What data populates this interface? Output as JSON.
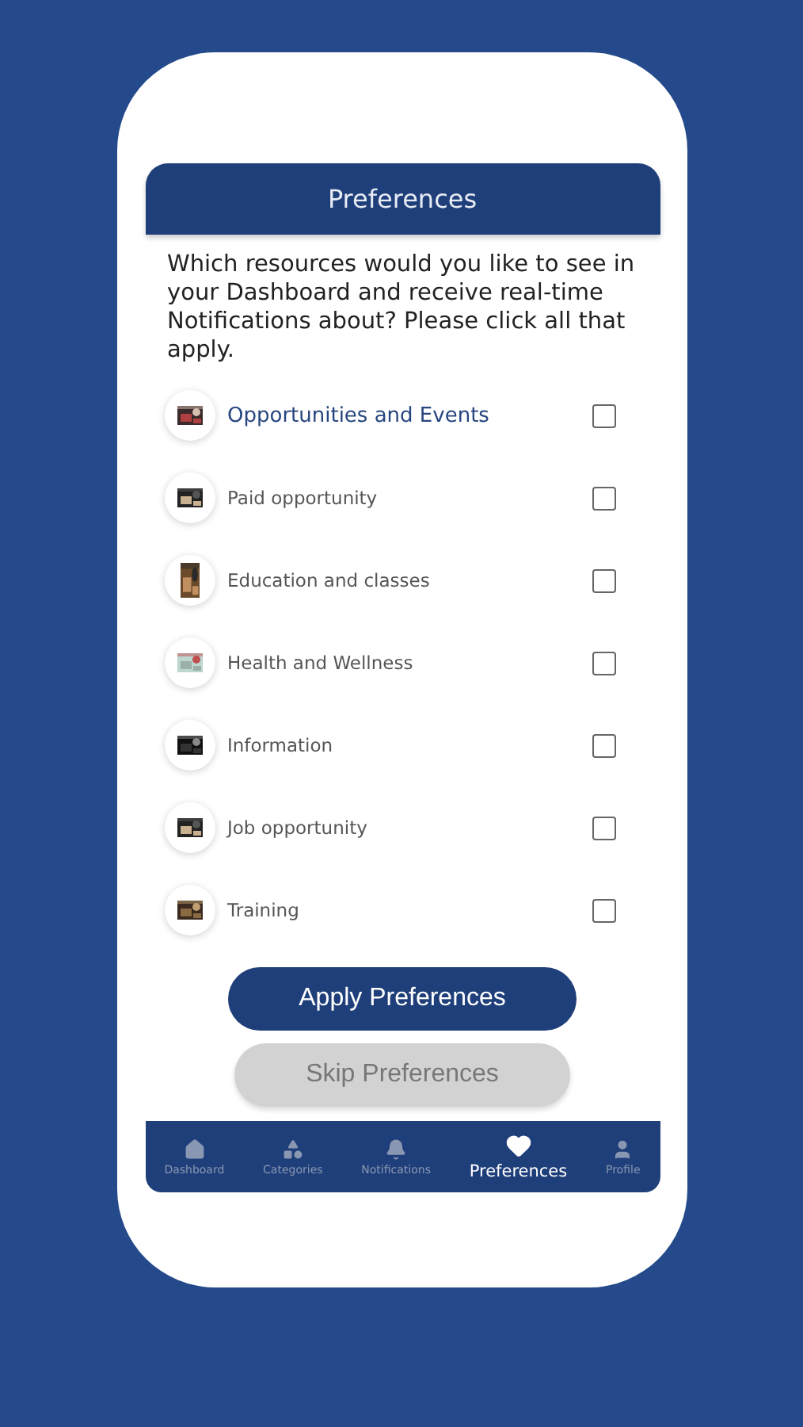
{
  "header": {
    "title": "Preferences"
  },
  "question": "Which resources would you like to see in your Dashboard and receive real-time Notifications about? Please click all that apply.",
  "resources": [
    {
      "label": "Opportunities and Events",
      "highlighted": true,
      "checked": false
    },
    {
      "label": "Paid opportunity",
      "highlighted": false,
      "checked": false
    },
    {
      "label": "Education and classes",
      "highlighted": false,
      "checked": false
    },
    {
      "label": "Health and Wellness",
      "highlighted": false,
      "checked": false
    },
    {
      "label": "Information",
      "highlighted": false,
      "checked": false
    },
    {
      "label": "Job opportunity",
      "highlighted": false,
      "checked": false
    },
    {
      "label": "Training",
      "highlighted": false,
      "checked": false
    }
  ],
  "buttons": [
    {
      "label": "Apply Preferences",
      "kind": "primary"
    },
    {
      "label": "Skip Preferences",
      "kind": "secondary"
    }
  ],
  "tab_bar": [
    {
      "label": "Dashboard",
      "selected": false
    },
    {
      "label": "Categories",
      "selected": false
    },
    {
      "label": "Notifications",
      "selected": false
    },
    {
      "label": "Preferences",
      "selected": true
    },
    {
      "label": "Profile",
      "selected": false
    }
  ]
}
